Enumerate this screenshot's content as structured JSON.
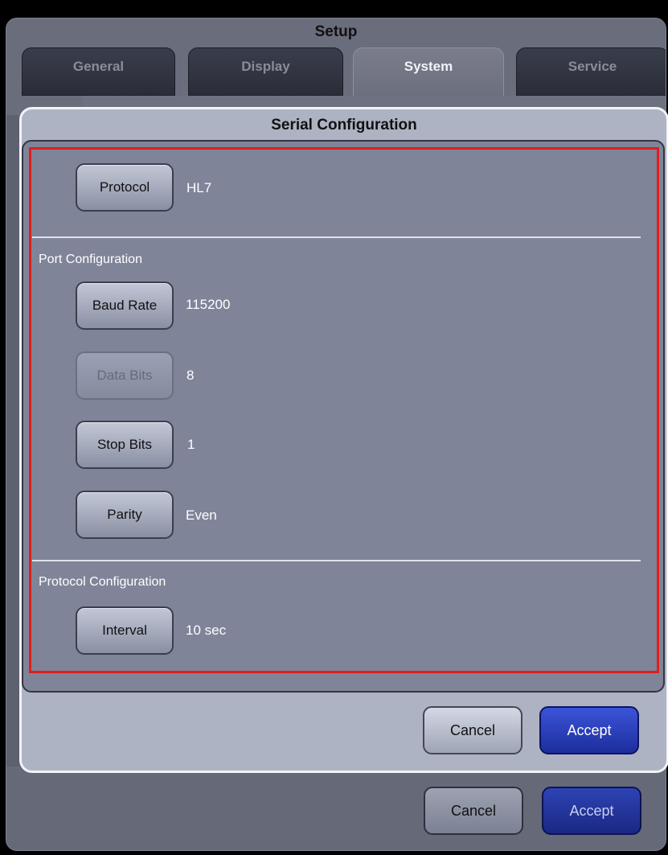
{
  "setup": {
    "title": "Setup",
    "tabs": [
      {
        "label": "General"
      },
      {
        "label": "Display"
      },
      {
        "label": "System"
      },
      {
        "label": "Service"
      }
    ]
  },
  "dialog": {
    "title": "Serial Configuration",
    "protocol": {
      "button": "Protocol",
      "value": "HL7"
    },
    "port_section_label": "Port Configuration",
    "baud_rate": {
      "button": "Baud Rate",
      "value": "115200"
    },
    "data_bits": {
      "button": "Data Bits",
      "value": "8"
    },
    "stop_bits": {
      "button": "Stop Bits",
      "value": "1"
    },
    "parity": {
      "button": "Parity",
      "value": "Even"
    },
    "protocol_section_label": "Protocol Configuration",
    "interval": {
      "button": "Interval",
      "value": "10 sec"
    },
    "cancel": "Cancel",
    "accept": "Accept"
  },
  "footer": {
    "cancel": "Cancel",
    "accept": "Accept"
  },
  "colors": {
    "highlight_border": "#e01e1e",
    "accept_button": "#2a3fc4"
  }
}
